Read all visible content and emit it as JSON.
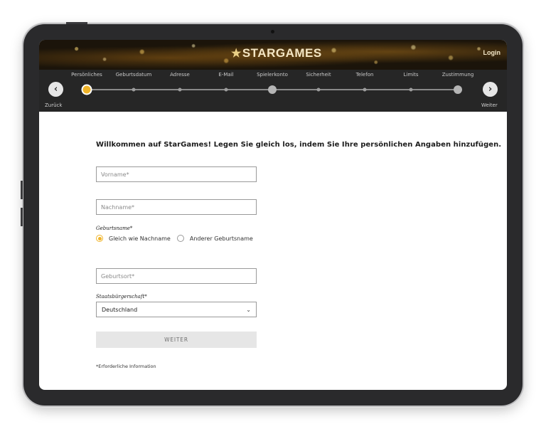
{
  "header": {
    "logo_text": "STARGAMES",
    "logo_star": "★",
    "login_label": "Login"
  },
  "stepper": {
    "steps": [
      {
        "label": "Persönliches",
        "state": "current"
      },
      {
        "label": "Geburtsdatum",
        "state": "upcoming"
      },
      {
        "label": "Adresse",
        "state": "upcoming"
      },
      {
        "label": "E-Mail",
        "state": "upcoming"
      },
      {
        "label": "Spielerkonto",
        "state": "milestone"
      },
      {
        "label": "Sicherheit",
        "state": "upcoming"
      },
      {
        "label": "Telefon",
        "state": "upcoming"
      },
      {
        "label": "Limits",
        "state": "upcoming"
      },
      {
        "label": "Zustimmung",
        "state": "milestone"
      }
    ],
    "back_label": "Zurück",
    "next_label": "Weiter",
    "back_icon": "‹",
    "next_icon": "›"
  },
  "form": {
    "welcome_text": "Willkommen auf StarGames! Legen Sie gleich los, indem Sie Ihre persönlichen Angaben hinzufügen.",
    "first_name_placeholder": "Vorname*",
    "last_name_placeholder": "Nachname*",
    "birth_name_label": "Geburtsname*",
    "birth_name_options": [
      {
        "label": "Gleich wie Nachname",
        "checked": true
      },
      {
        "label": "Anderer Geburtsname",
        "checked": false
      }
    ],
    "birthplace_placeholder": "Geburtsort*",
    "citizenship_label": "Staatsbürgerschaft*",
    "citizenship_value": "Deutschland",
    "submit_label": "WEITER",
    "required_note": "*Erforderliche Information"
  },
  "colors": {
    "accent": "#f0b429",
    "stepper_bg": "#262626"
  }
}
